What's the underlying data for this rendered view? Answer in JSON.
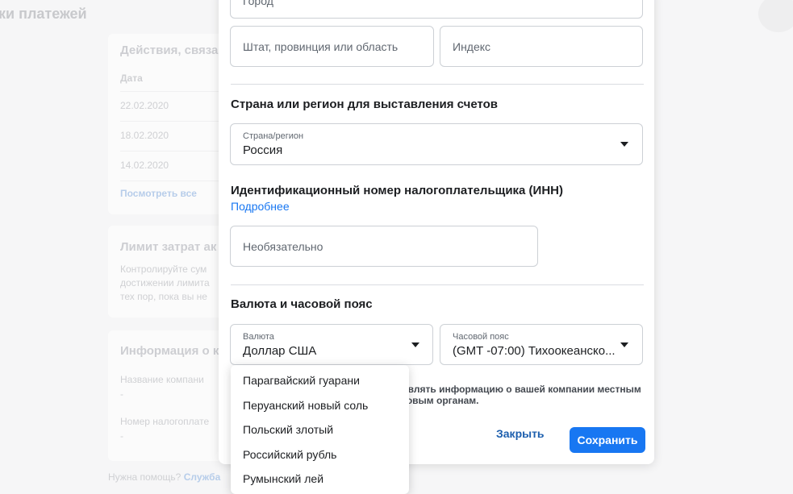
{
  "background": {
    "page_title": "ки платежей",
    "activity_card": {
      "title": "Действия, связа",
      "col_date": "Дата",
      "rows": [
        "22.02.2020",
        "18.02.2020",
        "14.02.2020"
      ],
      "view_all": "Посмотреть все"
    },
    "limit_card": {
      "title": "Лимит затрат ак",
      "lines": [
        "Контролируйте сум",
        "достижении лимита",
        "тех пор, пока вы не"
      ]
    },
    "info_card": {
      "title": "Информация о к",
      "company_label": "Название компани",
      "company_value": "-",
      "tax_label": "Номер налогоплате",
      "tax_value": "-"
    },
    "help": {
      "text": "Нужна помощь?",
      "link": "Служба"
    }
  },
  "modal": {
    "city_placeholder": "Город",
    "state_placeholder": "Штат, провинция или область",
    "zip_placeholder": "Индекс",
    "billing_country_section": "Страна или регион для выставления счетов",
    "country": {
      "label": "Страна/регион",
      "value": "Россия"
    },
    "tax_section": "Идентификационный номер налогоплательщика (ИНН)",
    "tax_more_link": "Подробнее",
    "tax_placeholder": "Необязательно",
    "currency_section": "Валюта и часовой пояс",
    "currency": {
      "label": "Валюта",
      "value": "Доллар США"
    },
    "timezone": {
      "label": "Часовой пояс",
      "value": "(GMT -07:00) Тихоокеанско..."
    },
    "note_lines": [
      "авлять информацию о вашей компании местным",
      "говым органам."
    ],
    "close_button": "Закрыть",
    "save_button": "Сохранить"
  },
  "currency_dropdown": {
    "options": [
      "Парагвайский гуарани",
      "Перуанский новый соль",
      "Польский злотый",
      "Российский рубль",
      "Румынский лей"
    ]
  },
  "colors": {
    "primary": "#1877f2",
    "link": "#1877f2",
    "text": "#1c1e21"
  }
}
